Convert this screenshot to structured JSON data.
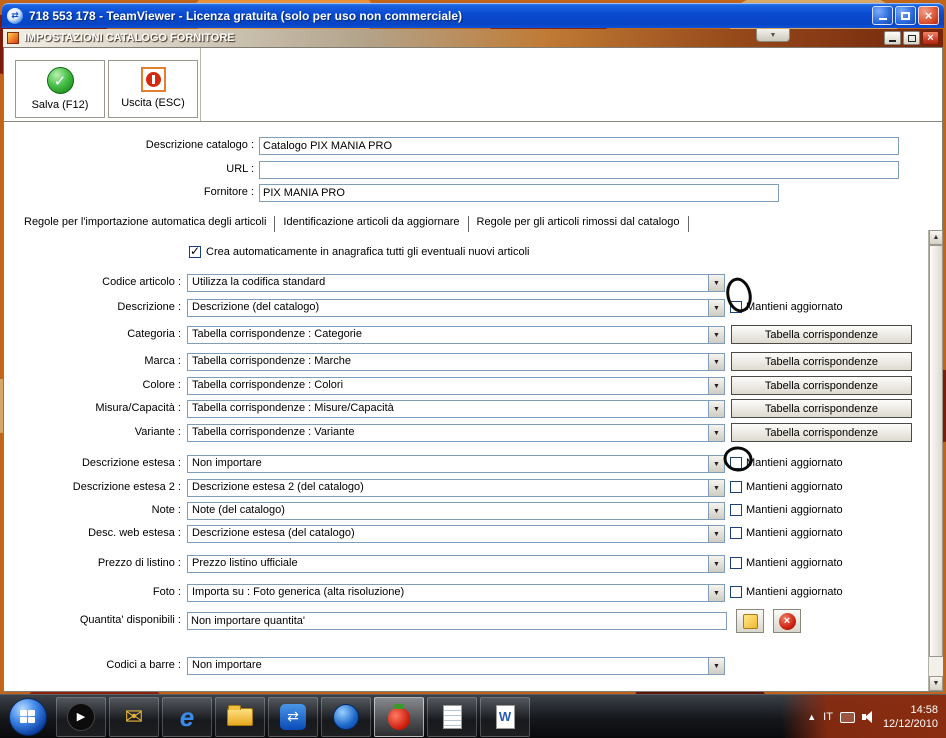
{
  "teamviewer": {
    "title": "718 553 178 - TeamViewer - Licenza gratuita (solo per uso non commerciale)"
  },
  "app_window": {
    "title": "IMPOSTAZIONI CATALOGO FORNITORE"
  },
  "toolbar": {
    "save": "Salva (F12)",
    "exit": "Uscita (ESC)"
  },
  "header_fields": {
    "catalog_label": "Descrizione catalogo :",
    "catalog_value": "Catalogo PIX MANIA PRO",
    "url_label": "URL :",
    "url_value": "",
    "supplier_label": "Fornitore :",
    "supplier_value": "PIX MANIA PRO"
  },
  "tabs": {
    "import_rules": "Regole per l'importazione automatica degli articoli",
    "identify": "Identificazione articoli da aggiornare",
    "removed": "Regole per gli articoli rimossi dal catalogo"
  },
  "options": {
    "auto_create_label": "Crea automaticamente in anagrafica tutti gli eventuali nuovi articoli",
    "auto_create_checked": true,
    "maintain_label": "Mantieni aggiornato",
    "tabella_button_label": "Tabella corrispondenze"
  },
  "rows": [
    {
      "label": "Codice articolo :",
      "value": "Utilizza la codifica standard"
    },
    {
      "label": "Descrizione :",
      "value": "Descrizione (del catalogo)",
      "maintain_checked": false
    },
    {
      "label": "Categoria :",
      "value": "Tabella corrispondenze : Categorie"
    },
    {
      "label": "Marca :",
      "value": "Tabella corrispondenze : Marche"
    },
    {
      "label": "Colore :",
      "value": "Tabella corrispondenze : Colori"
    },
    {
      "label": "Misura/Capacità :",
      "value": "Tabella corrispondenze : Misure/Capacità"
    },
    {
      "label": "Variante :",
      "value": "Tabella corrispondenze : Variante"
    },
    {
      "label": "Descrizione estesa :",
      "value": "Non importare",
      "maintain_checked": false
    },
    {
      "label": "Descrizione estesa 2 :",
      "value": "Descrizione estesa 2 (del catalogo)",
      "maintain_checked": false
    },
    {
      "label": "Note :",
      "value": "Note (del catalogo)",
      "maintain_checked": false
    },
    {
      "label": "Desc. web estesa :",
      "value": "Descrizione estesa (del catalogo)",
      "maintain_checked": false
    },
    {
      "label": "Prezzo di listino :",
      "value": "Prezzo listino ufficiale",
      "maintain_checked": false
    },
    {
      "label": "Foto :",
      "value": "Importa su : Foto generica (alta risoluzione)",
      "maintain_checked": false
    },
    {
      "label": "Quantita' disponibili :",
      "value": "Non importare quantita'"
    },
    {
      "label": "Codici a barre :",
      "value": "Non importare"
    }
  ],
  "annotations": {
    "circle_1": "hand-drawn circle near Codice articolo dropdown arrow",
    "circle_2": "hand-drawn circle around Mantieni aggiornato checkbox of Descrizione estesa"
  },
  "taskbar": {
    "language": "IT",
    "time": "14:58",
    "date": "12/12/2010"
  },
  "colors": {
    "titlebar_blue": "#0a4ad0",
    "close_red": "#d0402a",
    "camo_orange": "#c2641a",
    "save_green": "#1c8c1c",
    "exit_red": "#d42a10"
  }
}
